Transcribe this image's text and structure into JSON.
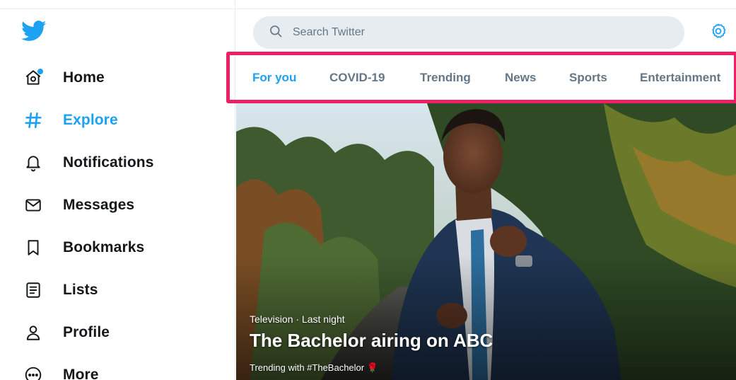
{
  "sidebar": {
    "logo": "twitter-bird-icon",
    "items": [
      {
        "label": "Home",
        "icon": "home-icon"
      },
      {
        "label": "Explore",
        "icon": "hashtag-icon"
      },
      {
        "label": "Notifications",
        "icon": "bell-icon"
      },
      {
        "label": "Messages",
        "icon": "envelope-icon"
      },
      {
        "label": "Bookmarks",
        "icon": "bookmark-icon"
      },
      {
        "label": "Lists",
        "icon": "list-icon"
      },
      {
        "label": "Profile",
        "icon": "person-icon"
      },
      {
        "label": "More",
        "icon": "more-icon"
      }
    ]
  },
  "search": {
    "placeholder": "Search Twitter",
    "value": ""
  },
  "tabs": [
    {
      "label": "For you"
    },
    {
      "label": "COVID-19"
    },
    {
      "label": "Trending"
    },
    {
      "label": "News"
    },
    {
      "label": "Sports"
    },
    {
      "label": "Entertainment"
    }
  ],
  "active_tab": "For you",
  "hero": {
    "meta": "Television · Last night",
    "title": "The Bachelor airing on ABC",
    "trending": "Trending with #TheBachelor 🌹"
  },
  "colors": {
    "accent": "#1da1f2",
    "highlight": "#ee1f66",
    "muted": "#657786",
    "search_bg": "#e6ecf0"
  }
}
